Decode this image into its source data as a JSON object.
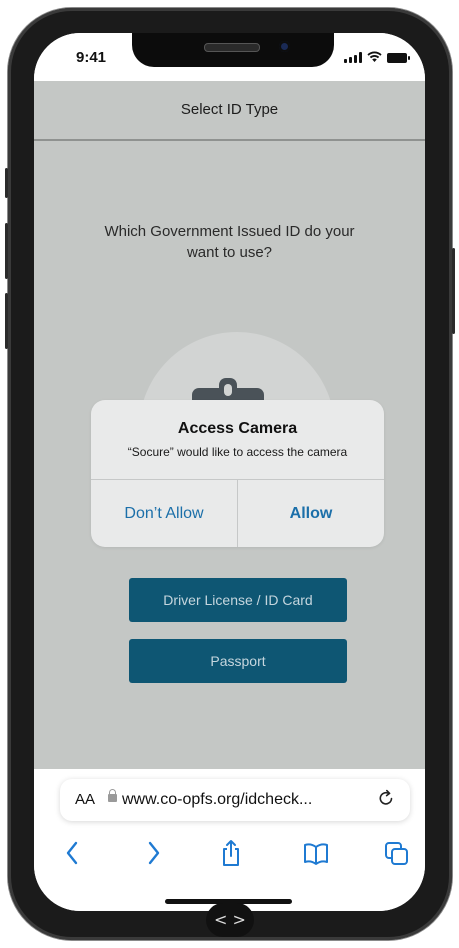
{
  "status_bar": {
    "time": "9:41"
  },
  "header": {
    "title": "Select ID Type"
  },
  "main": {
    "question": "Which Government Issued ID do your want to use?",
    "icon": "id-badge-icon",
    "buttons": {
      "driver_license": "Driver License / ID Card",
      "passport": "Passport"
    }
  },
  "alert": {
    "title": "Access Camera",
    "message": "“Socure” would like to access the camera",
    "deny_label": "Don’t Allow",
    "allow_label": "Allow"
  },
  "browser": {
    "text_size_label": "AA",
    "url": "www.co-opfs.org/idcheck...",
    "toolbar_icons": [
      "back-icon",
      "forward-icon",
      "share-icon",
      "bookmarks-icon",
      "tabs-icon"
    ]
  },
  "page_nav": {
    "label": "< >"
  },
  "colors": {
    "page_background": "#c4c7c5",
    "primary_button": "#0e5673",
    "alert_link": "#1b6fa9",
    "browser_accent": "#1f7ad2"
  }
}
